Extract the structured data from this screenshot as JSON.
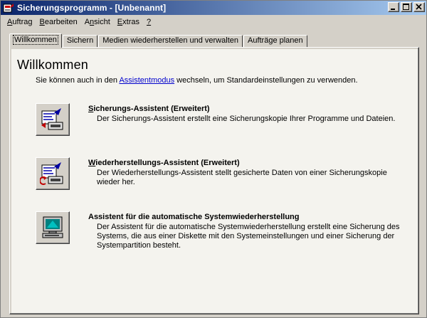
{
  "window": {
    "title": "Sicherungsprogramm - [Unbenannt]"
  },
  "menu": [
    {
      "first": "A",
      "rest": "uftrag"
    },
    {
      "first": "B",
      "rest": "earbeiten"
    },
    {
      "first": "A",
      "rest": "nsicht",
      "prefix": ""
    },
    {
      "first": "E",
      "rest": "xtras"
    },
    {
      "first": "?",
      "rest": ""
    }
  ],
  "tabs": [
    {
      "label": "Willkommen",
      "active": true
    },
    {
      "label": "Sichern"
    },
    {
      "label": "Medien wiederherstellen und verwalten"
    },
    {
      "label": "Aufträge planen"
    }
  ],
  "welcome": {
    "heading": "Willkommen",
    "intro_before": "Sie können auch in den ",
    "intro_link": "Assistentmodus",
    "intro_after": " wechseln, um Standardeinstellungen zu verwenden."
  },
  "options": [
    {
      "title_first": "S",
      "title_rest": "icherungs-Assistent (Erweitert)",
      "description": "Der Sicherungs-Assistent erstellt eine Sicherungskopie Ihrer Programme und Dateien.",
      "icon": "backup-wizard-icon"
    },
    {
      "title_first": "W",
      "title_rest": "iederherstellungs-Assistent (Erweitert)",
      "description": "Der Wiederherstellungs-Assistent stellt gesicherte Daten von einer Sicherungskopie wieder her.",
      "icon": "restore-wizard-icon"
    },
    {
      "title_first": "",
      "title_rest": "Assistent für die automatische Systemwiederherstellung",
      "description": "Der Assistent für die automatische Systemwiederherstellung erstellt eine Sicherung des Systems, die aus einer Diskette mit den Systemeinstellungen und einer Sicherung der Systempartition besteht.",
      "icon": "system-recovery-icon"
    }
  ]
}
